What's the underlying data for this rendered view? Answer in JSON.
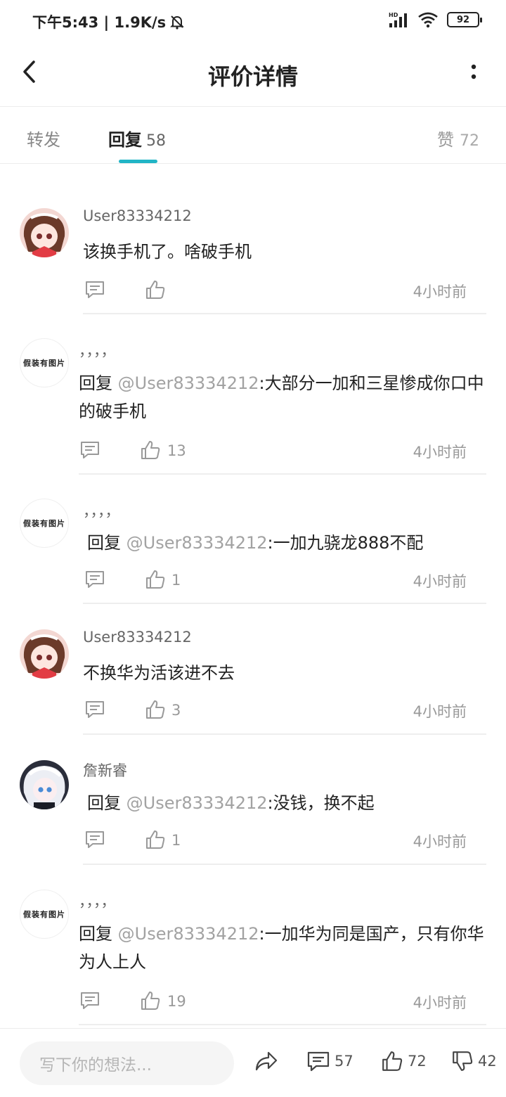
{
  "status_bar": {
    "time_speed": "下午5:43 | 1.9K/s",
    "battery": "92",
    "hd_label": "HD"
  },
  "header": {
    "title": "评价详情"
  },
  "tabs": {
    "forward_label": "转发",
    "reply_label": "回复",
    "reply_count": "58",
    "like_label": "赞",
    "like_count": "72"
  },
  "placeholder_avatar_text": "假装有图片",
  "colors": {
    "accent": "#21b5c6",
    "mention": "#a2a2a2",
    "muted": "#999999"
  },
  "comments": [
    {
      "username": "User83334212",
      "reply_prefix": "",
      "mention": "",
      "text": "该换手机了。啥破手机",
      "likes": "",
      "time": "4小时前",
      "avatar": "anime-girl-red"
    },
    {
      "username": "，，，，",
      "reply_prefix": "回复 ",
      "mention": "@User83334212",
      "text": ":大部分一加和三星惨成你口中的破手机",
      "likes": "13",
      "time": "4小时前",
      "avatar": "placeholder"
    },
    {
      "username": "，，，，",
      "reply_prefix": "回复 ",
      "mention": "@User83334212",
      "text": ":一加九骁龙888不配",
      "likes": "1",
      "time": "4小时前",
      "avatar": "placeholder"
    },
    {
      "username": "User83334212",
      "reply_prefix": "",
      "mention": "",
      "text": "不换华为活该进不去",
      "likes": "3",
      "time": "4小时前",
      "avatar": "anime-girl-red"
    },
    {
      "username": "詹新睿",
      "reply_prefix": "回复 ",
      "mention": "@User83334212",
      "text": ":没钱，换不起",
      "likes": "1",
      "time": "4小时前",
      "avatar": "anime-girl-white"
    },
    {
      "username": "，，，，",
      "reply_prefix": "回复 ",
      "mention": "@User83334212",
      "text": ":一加华为同是国产，只有你华为人上人",
      "likes": "19",
      "time": "4小时前",
      "avatar": "placeholder"
    }
  ],
  "bottom_bar": {
    "input_placeholder": "写下你的想法...",
    "comment_count": "57",
    "like_count": "72",
    "dislike_count": "42"
  }
}
